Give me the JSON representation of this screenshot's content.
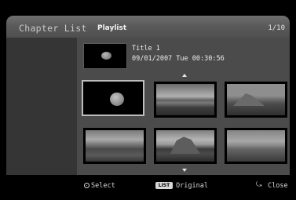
{
  "header": {
    "title": "Chapter List",
    "subtitle": "Playlist",
    "page_indicator": "1/10"
  },
  "info": {
    "title": "Title 1",
    "datetime": "09/01/2007  Tue  00:30:56"
  },
  "thumbnails": [
    {
      "selected": true,
      "icon": "disc-placeholder"
    },
    {
      "selected": false
    },
    {
      "selected": false
    },
    {
      "selected": false
    },
    {
      "selected": false
    },
    {
      "selected": false
    }
  ],
  "footer": {
    "select_label": "Select",
    "list_key": "LIST",
    "original_label": "Original",
    "close_label": "Close"
  },
  "icons": {
    "select": "enter-circle-icon",
    "list": "list-key-icon",
    "close": "return-arrow-icon",
    "scroll_up": "arrow-up-icon",
    "scroll_down": "arrow-down-icon"
  }
}
